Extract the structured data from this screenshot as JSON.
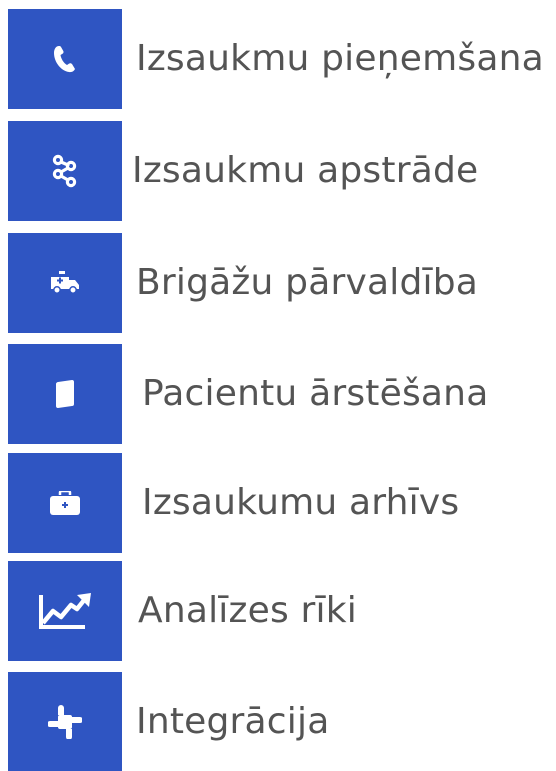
{
  "menu": {
    "accent_color": "#2f55c2",
    "items": [
      {
        "label": "Izsaukmu pieņemšana",
        "icon": "phone-icon"
      },
      {
        "label": "Izsaukmu apstrāde",
        "icon": "workflow-icon"
      },
      {
        "label": "Brigāžu pārvaldība",
        "icon": "ambulance-icon"
      },
      {
        "label": "Pacientu ārstēšana",
        "icon": "folder-icon"
      },
      {
        "label": "Izsaukumu arhīvs",
        "icon": "medical-kit-icon"
      },
      {
        "label": "Analīzes rīki",
        "icon": "chart-trend-icon"
      },
      {
        "label": "Integrācija",
        "icon": "integration-icon"
      }
    ]
  }
}
